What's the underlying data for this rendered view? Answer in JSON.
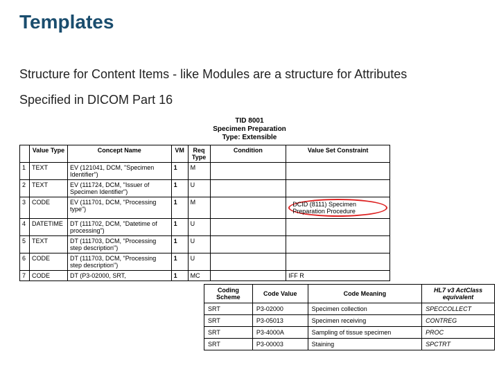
{
  "title": "Templates",
  "para1": "Structure for Content Items - like Modules are a structure for Attributes",
  "para2": "Specified in DICOM Part 16",
  "template": {
    "header_id": "TID 8001",
    "header_name": "Specimen Preparation",
    "header_type": "Type: Extensible",
    "columns": {
      "c0": "",
      "c1": "Value Type",
      "c2": "Concept Name",
      "c3": "VM",
      "c4": "Req Type",
      "c5": "Condition",
      "c6": "Value Set Constraint"
    },
    "rows": [
      {
        "n": "1",
        "vt": "TEXT",
        "cn": "EV (121041, DCM, \"Specimen Identifier\")",
        "vm": "1",
        "req": "M",
        "cond": "",
        "vsc": ""
      },
      {
        "n": "2",
        "vt": "TEXT",
        "cn": "EV (111724, DCM, \"Issuer of Specimen Identifier\")",
        "vm": "1",
        "req": "U",
        "cond": "",
        "vsc": ""
      },
      {
        "n": "3",
        "vt": "CODE",
        "cn": "EV (111701, DCM, \"Processing type\")",
        "vm": "1",
        "req": "M",
        "cond": "",
        "vsc": "DCID (8111) Specimen Preparation Procedure"
      },
      {
        "n": "4",
        "vt": "DATETIME",
        "cn": "DT (111702, DCM, \"Datetime of processing\")",
        "vm": "1",
        "req": "U",
        "cond": "",
        "vsc": ""
      },
      {
        "n": "5",
        "vt": "TEXT",
        "cn": "DT (111703, DCM, \"Processing step description\")",
        "vm": "1",
        "req": "U",
        "cond": "",
        "vsc": ""
      },
      {
        "n": "6",
        "vt": "CODE",
        "cn": "DT (111703, DCM, \"Processing step description\")",
        "vm": "1",
        "req": "U",
        "cond": "",
        "vsc": ""
      },
      {
        "n": "7",
        "vt": "CODE",
        "cn": "DT (P3-02000, SRT,",
        "vm": "1",
        "req": "MC",
        "cond": "",
        "vsc": "IFF R"
      }
    ]
  },
  "codeset": {
    "columns": {
      "c1": "Coding Scheme",
      "c2": "Code Value",
      "c3": "Code Meaning",
      "c4": "HL7 v3 ActClass equivalent"
    },
    "rows": [
      {
        "scheme": "SRT",
        "value": "P3-02000",
        "meaning": "Specimen collection",
        "hl7": "SPECCOLLECT"
      },
      {
        "scheme": "SRT",
        "value": "P3-05013",
        "meaning": "Specimen receiving",
        "hl7": "CONTREG"
      },
      {
        "scheme": "SRT",
        "value": "P3-4000A",
        "meaning": "Sampling of tissue specimen",
        "hl7": "PROC"
      },
      {
        "scheme": "SRT",
        "value": "P3-00003",
        "meaning": "Staining",
        "hl7": "SPCTRT"
      }
    ]
  }
}
